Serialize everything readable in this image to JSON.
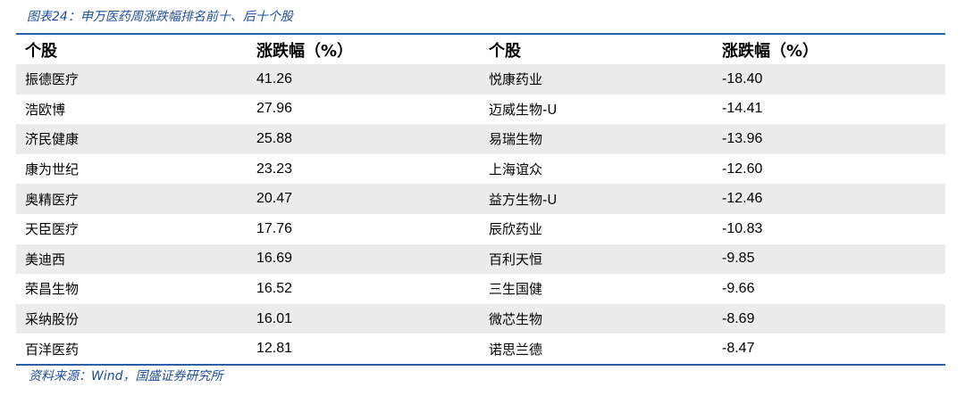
{
  "caption": "图表24：申万医药周涨跌幅排名前十、后十个股",
  "headers": [
    "个股",
    "涨跌幅（%）",
    "个股",
    "涨跌幅（%）"
  ],
  "rows": [
    [
      "振德医疗",
      "41.26",
      "悦康药业",
      "-18.40"
    ],
    [
      "浩欧博",
      "27.96",
      "迈威生物-U",
      "-14.41"
    ],
    [
      "济民健康",
      "25.88",
      "易瑞生物",
      "-13.96"
    ],
    [
      "康为世纪",
      "23.23",
      "上海谊众",
      "-12.60"
    ],
    [
      "奥精医疗",
      "20.47",
      "益方生物-U",
      "-12.46"
    ],
    [
      "天臣医疗",
      "17.76",
      "辰欣药业",
      "-10.83"
    ],
    [
      "美迪西",
      "16.69",
      "百利天恒",
      "-9.85"
    ],
    [
      "荣昌生物",
      "16.52",
      "三生国健",
      "-9.66"
    ],
    [
      "采纳股份",
      "16.01",
      "微芯生物",
      "-8.69"
    ],
    [
      "百洋医药",
      "12.81",
      "诺思兰德",
      "-8.47"
    ]
  ],
  "source": "资料来源：Wind，国盛证券研究所",
  "colors": {
    "accent": "#2b5faa",
    "caption": "#1f4e9c",
    "stripe": "#ececed"
  }
}
